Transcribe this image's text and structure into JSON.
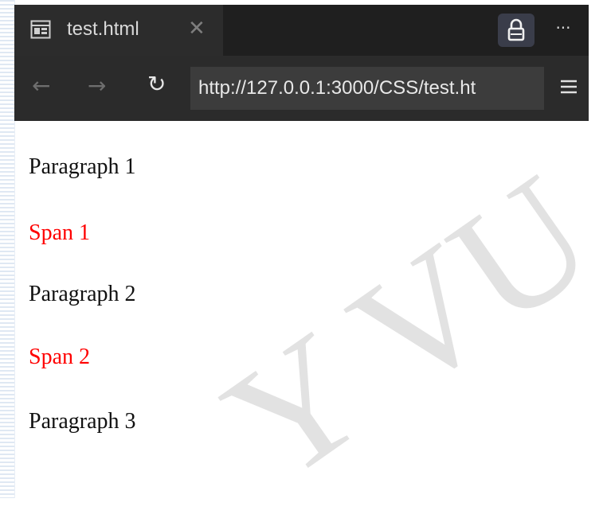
{
  "tab": {
    "title": "test.html",
    "close": "✕"
  },
  "toolbar": {
    "more": "···"
  },
  "nav": {
    "back": "←",
    "forward": "→",
    "reload": "↻",
    "url": "http://127.0.0.1:3000/CSS/test.ht"
  },
  "page": {
    "lines": [
      {
        "text": "Paragraph 1",
        "kind": "paragraph"
      },
      {
        "text": "Span 1",
        "kind": "span"
      },
      {
        "text": "Paragraph 2",
        "kind": "paragraph"
      },
      {
        "text": "Span 2",
        "kind": "span"
      },
      {
        "text": "Paragraph 3",
        "kind": "paragraph"
      }
    ]
  },
  "watermark": "Y VU",
  "colors": {
    "span_text": "#ff0000",
    "paragraph_text": "#111111",
    "chrome_bg": "#1f1f1f",
    "navbar_bg": "#2b2b2b",
    "urlbar_bg": "#3c3c3c",
    "lock_button_bg": "#3a3d4a"
  }
}
